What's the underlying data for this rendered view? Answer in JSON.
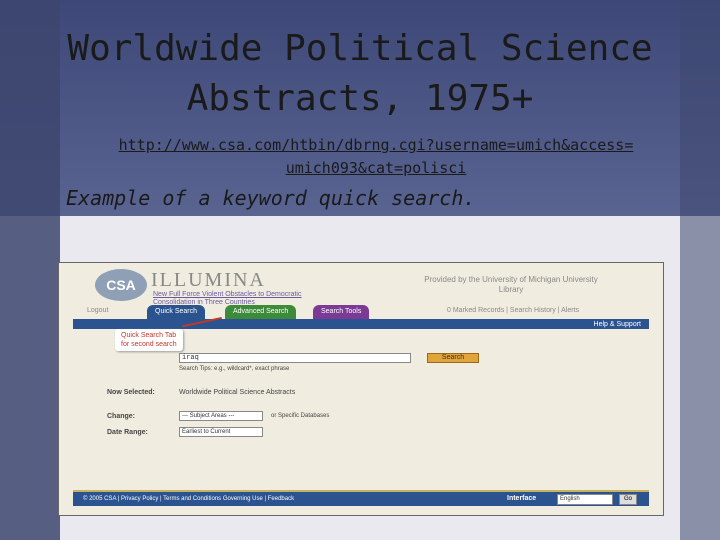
{
  "slide": {
    "title_line1": "Worldwide Political Science",
    "title_line2": "Abstracts, 1975+",
    "url_line1": "http://www.csa.com/htbin/dbrng.cgi?username=umich&access=",
    "url_line2": "umich093&cat=polisci",
    "subtitle": "Example of a keyword quick search."
  },
  "screenshot": {
    "logo_text": "CSA",
    "brand": "ILLUMINA",
    "news_link": "New Full Force Violent Obstacles to Democratic",
    "news_line2": "Consolidation in Three Countries",
    "provided_by": "Provided by the University of Michigan University Library",
    "logout": "Logout",
    "tabs": [
      "Quick Search",
      "Advanced Search",
      "Search Tools"
    ],
    "right_nav": "0 Marked Records | Search History | Alerts",
    "help": "Help & Support",
    "callout_line1": "Quick Search Tab",
    "callout_line2": "for second search",
    "search_value": "iraq",
    "search_button": "Search",
    "search_tips": "Search Tips: e.g., wildcard*, exact phrase",
    "now_selected_label": "Now Selected:",
    "now_selected_value": "Worldwide Political Science Abstracts",
    "change_label": "Change:",
    "change_value": "--- Subject Areas ---",
    "or_specific": "or Specific Databases",
    "date_label": "Date Range:",
    "date_value": "Earliest to Current",
    "footer": "© 2005 CSA | Privacy Policy | Terms and Conditions Governing Use | Feedback",
    "interface_label": "Interface",
    "interface_value": "English",
    "go_button": "Go"
  },
  "colors": {
    "tab_quick": "#2a5390",
    "tab_advanced": "#3e8a3b",
    "tab_tools": "#7b3b94",
    "search_button": "#e0a43a",
    "callout_text": "#c0392b"
  }
}
